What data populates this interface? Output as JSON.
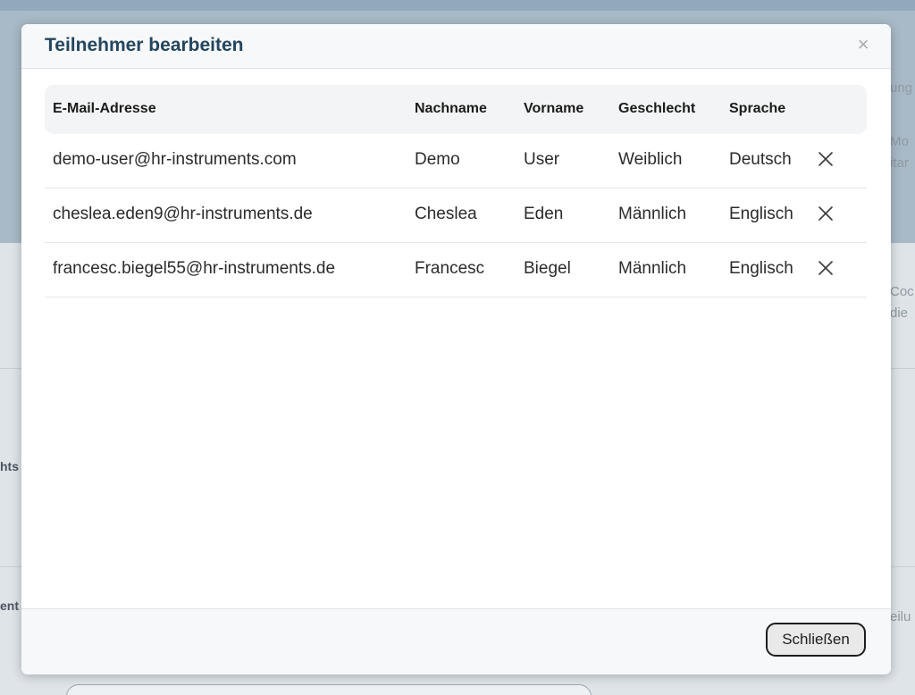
{
  "background": {
    "right_fragments": [
      "ung",
      "Mo",
      "itar",
      "Coc",
      "die",
      "eilu"
    ],
    "left_fragments": [
      "hts",
      "ent"
    ]
  },
  "modal": {
    "title": "Teilnehmer bearbeiten",
    "close_glyph": "×",
    "columns": {
      "email": "E-Mail-Adresse",
      "last_name": "Nachname",
      "first_name": "Vorname",
      "gender": "Geschlecht",
      "language": "Sprache"
    },
    "rows": [
      {
        "email": "demo-user@hr-instruments.com",
        "last_name": "Demo",
        "first_name": "User",
        "gender": "Weiblich",
        "language": "Deutsch"
      },
      {
        "email": "cheslea.eden9@hr-instruments.de",
        "last_name": "Cheslea",
        "first_name": "Eden",
        "gender": "Männlich",
        "language": "Englisch"
      },
      {
        "email": "francesc.biegel55@hr-instruments.de",
        "last_name": "Francesc",
        "first_name": "Biegel",
        "gender": "Männlich",
        "language": "Englisch"
      }
    ],
    "footer": {
      "close_label": "Schließen"
    }
  },
  "colors": {
    "title": "#24465e",
    "overlay": "#b9c6d0",
    "header_row": "#f3f4f5"
  }
}
